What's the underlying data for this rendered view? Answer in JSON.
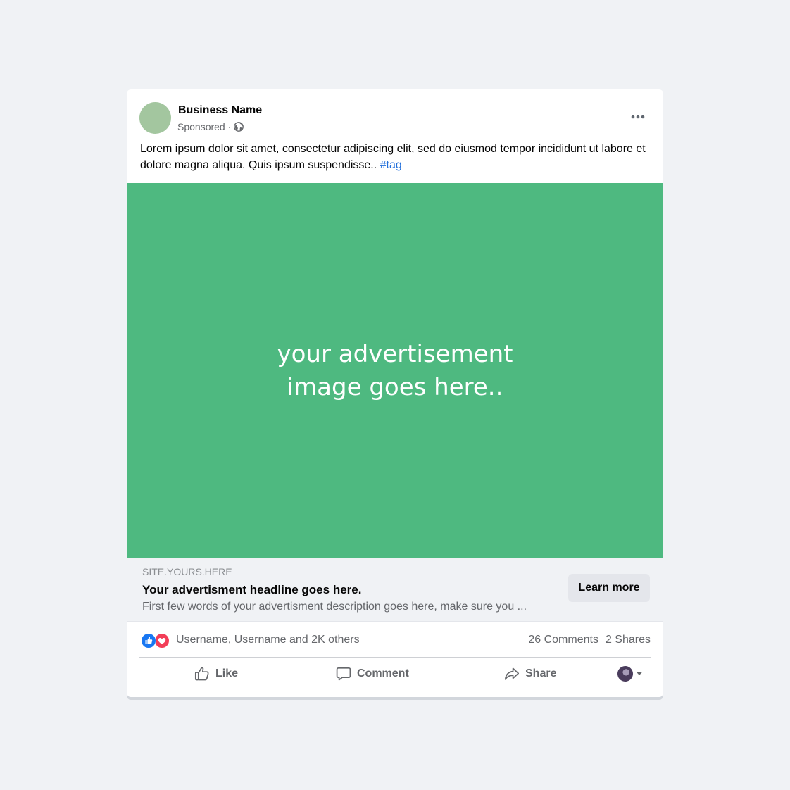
{
  "post": {
    "business_name": "Business Name",
    "sponsored_label": "Sponsored",
    "separator": "·",
    "caption_text": "Lorem ipsum dolor sit amet, consectetur adipiscing elit, sed do eiusmod tempor incididunt ut labore et dolore magna aliqua. Quis ipsum suspendisse..",
    "caption_tag": "#tag",
    "image_placeholder_line1": "your advertisement",
    "image_placeholder_line2": "image goes here.."
  },
  "link": {
    "site": "SITE.YOURS.HERE",
    "headline": "Your advertisment headline goes here.",
    "description": "First few words of your advertisment description goes here, make sure you ...",
    "cta_label": "Learn more"
  },
  "engagement": {
    "reactions_text": "Username, Username and 2K others",
    "comments": "26 Comments",
    "shares": "2 Shares"
  },
  "actions": {
    "like_label": "Like",
    "comment_label": "Comment",
    "share_label": "Share"
  },
  "icons": {
    "more": "more-horizontal-icon",
    "globe": "globe-icon",
    "like_reaction": "like-reaction-icon",
    "love_reaction": "love-reaction-icon",
    "like": "thumbs-up-icon",
    "comment": "comment-bubble-icon",
    "share": "share-arrow-icon",
    "dropdown": "caret-down-icon"
  },
  "colors": {
    "page_background": "#f0f2f5",
    "ad_image": "#4eb980",
    "avatar": "#a3c69f",
    "tag_link": "#216fdb",
    "like_reaction": "#1877f2",
    "love_reaction": "#f33e58"
  }
}
